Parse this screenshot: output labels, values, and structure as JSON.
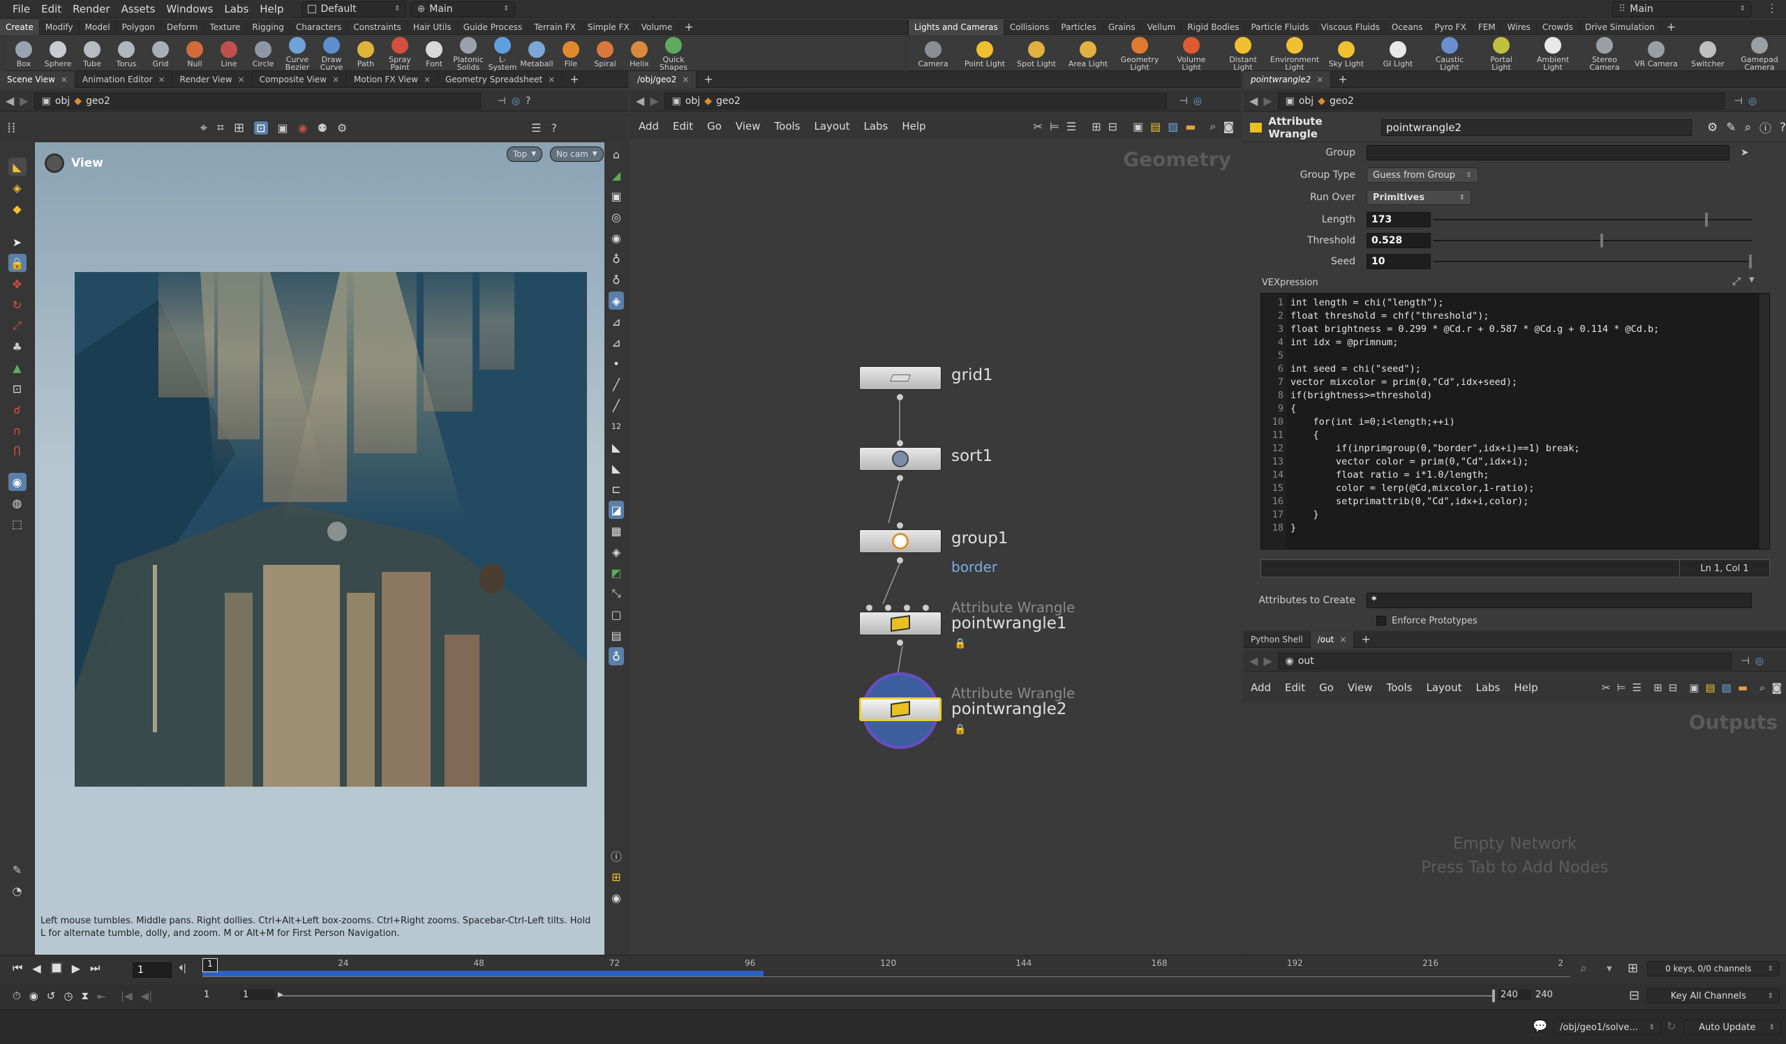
{
  "menubar": {
    "items": [
      "File",
      "Edit",
      "Render",
      "Assets",
      "Windows",
      "Labs",
      "Help"
    ],
    "desktop": "Default",
    "context": "Main",
    "right_context": "Main"
  },
  "shelf_left": {
    "tabs": [
      "Create",
      "Modify",
      "Model",
      "Polygon",
      "Deform",
      "Texture",
      "Rigging",
      "Characters",
      "Constraints",
      "Hair Utils",
      "Guide Process",
      "Terrain FX",
      "Simple FX",
      "Volume"
    ],
    "tools": [
      {
        "label": "Box",
        "color": "#9aa4b0"
      },
      {
        "label": "Sphere",
        "color": "#c8ccd2"
      },
      {
        "label": "Tube",
        "color": "#b7bcc3"
      },
      {
        "label": "Torus",
        "color": "#b0b6bd"
      },
      {
        "label": "Grid",
        "color": "#a9afb6"
      },
      {
        "label": "Null",
        "color": "#d46a3a"
      },
      {
        "label": "Line",
        "color": "#c0504d"
      },
      {
        "label": "Circle",
        "color": "#8e97a3"
      },
      {
        "label": "Curve Bezier",
        "color": "#6fa3d8"
      },
      {
        "label": "Draw Curve",
        "color": "#5b8fd0"
      },
      {
        "label": "Path",
        "color": "#e0b23a"
      },
      {
        "label": "Spray Paint",
        "color": "#d2503d"
      },
      {
        "label": "Font",
        "color": "#d9d9d9"
      },
      {
        "label": "Platonic Solids",
        "color": "#9aa1ab"
      },
      {
        "label": "L-System",
        "color": "#5da0e0"
      },
      {
        "label": "Metaball",
        "color": "#7aa7d6"
      },
      {
        "label": "File",
        "color": "#e08a2c"
      },
      {
        "label": "Spiral",
        "color": "#d9783a"
      },
      {
        "label": "Helix",
        "color": "#d98a3a"
      },
      {
        "label": "Quick Shapes",
        "color": "#5faa5f"
      }
    ]
  },
  "shelf_right": {
    "tabs": [
      "Lights and Cameras",
      "Collisions",
      "Particles",
      "Grains",
      "Vellum",
      "Rigid Bodies",
      "Particle Fluids",
      "Viscous Fluids",
      "Oceans",
      "Pyro FX",
      "FEM",
      "Wires",
      "Crowds",
      "Drive Simulation"
    ],
    "tools": [
      {
        "label": "Camera",
        "color": "#8a8f96"
      },
      {
        "label": "Point Light",
        "color": "#f0c030"
      },
      {
        "label": "Spot Light",
        "color": "#e0b040"
      },
      {
        "label": "Area Light",
        "color": "#e0b040"
      },
      {
        "label": "Geometry Light",
        "color": "#e07a30"
      },
      {
        "label": "Volume Light",
        "color": "#e05a30"
      },
      {
        "label": "Distant Light",
        "color": "#f0c030"
      },
      {
        "label": "Environment Light",
        "color": "#f0c030"
      },
      {
        "label": "Sky Light",
        "color": "#f0c030"
      },
      {
        "label": "GI Light",
        "color": "#e8e8e8"
      },
      {
        "label": "Caustic Light",
        "color": "#6a8fd0"
      },
      {
        "label": "Portal Light",
        "color": "#c0c040"
      },
      {
        "label": "Ambient Light",
        "color": "#e8e8e8"
      },
      {
        "label": "Stereo Camera",
        "color": "#9a9fa6"
      },
      {
        "label": "VR Camera",
        "color": "#9a9fa6"
      },
      {
        "label": "Switcher",
        "color": "#bfbfbf"
      },
      {
        "label": "Gamepad Camera",
        "color": "#9a9fa6"
      }
    ]
  },
  "viewport": {
    "tabs": [
      "Scene View",
      "Animation Editor",
      "Render View",
      "Composite View",
      "Motion FX View",
      "Geometry Spreadsheet"
    ],
    "path": {
      "root": "obj",
      "node": "geo2"
    },
    "title": "View",
    "view_mode": "Top",
    "camera": "No cam",
    "hint": "Left mouse tumbles. Middle pans. Right dollies. Ctrl+Alt+Left box-zooms. Ctrl+Right zooms. Spacebar-Ctrl-Left tilts. Hold L for alternate tumble, dolly, and zoom. M or Alt+M for First Person Navigation."
  },
  "network": {
    "tab": "/obj/geo2",
    "path": {
      "root": "obj",
      "node": "geo2"
    },
    "menu": [
      "Add",
      "Edit",
      "Go",
      "View",
      "Tools",
      "Layout",
      "Labs",
      "Help"
    ],
    "context_label": "Geometry",
    "nodes": [
      {
        "name": "grid1",
        "type": ""
      },
      {
        "name": "sort1",
        "type": ""
      },
      {
        "name": "group1",
        "type": "",
        "sub": "border"
      },
      {
        "name": "pointwrangle1",
        "type": "Attribute Wrangle"
      },
      {
        "name": "pointwrangle2",
        "type": "Attribute Wrangle"
      }
    ]
  },
  "params": {
    "tab": "pointwrangle2",
    "path": {
      "root": "obj",
      "node": "geo2"
    },
    "node_type": "Attribute Wrangle",
    "node_name": "pointwrangle2",
    "group_label": "Group",
    "group_value": "",
    "group_type_label": "Group Type",
    "group_type_value": "Guess from Group",
    "run_over_label": "Run Over",
    "run_over_value": "Primitives",
    "length_label": "Length",
    "length_value": "173",
    "length_fraction": 0.86,
    "threshold_label": "Threshold",
    "threshold_value": "0.528",
    "threshold_fraction": 0.528,
    "seed_label": "Seed",
    "seed_value": "10",
    "seed_fraction": 1.0,
    "vex_label": "VEXpression",
    "code_lines": [
      "int length = chi(\"length\");",
      "float threshold = chf(\"threshold\");",
      "float brightness = 0.299 * @Cd.r + 0.587 * @Cd.g + 0.114 * @Cd.b;",
      "int idx = @primnum;",
      "",
      "int seed = chi(\"seed\");",
      "vector mixcolor = prim(0,\"Cd\",idx+seed);",
      "if(brightness>=threshold)",
      "{",
      "    for(int i=0;i<length;++i)",
      "    {",
      "        if(inprimgroup(0,\"border\",idx+i)==1) break;",
      "        vector color = prim(0,\"Cd\",idx+i);",
      "        float ratio = i*1.0/length;",
      "        color = lerp(@Cd,mixcolor,1-ratio);",
      "        setprimattrib(0,\"Cd\",idx+i,color);",
      "    }",
      "}"
    ],
    "cursor_pos": "Ln 1, Col 1",
    "attr_create_label": "Attributes to Create",
    "attr_create_value": "*",
    "enforce_label": "Enforce Prototypes"
  },
  "outputs": {
    "tabs": [
      "Python Shell",
      "/out"
    ],
    "path": "out",
    "menu": [
      "Add",
      "Edit",
      "Go",
      "View",
      "Tools",
      "Layout",
      "Labs",
      "Help"
    ],
    "context_label": "Outputs",
    "empty_line1": "Empty Network",
    "empty_line2": "Press Tab to Add Nodes"
  },
  "timeline": {
    "current_frame": "1",
    "frame_marker": "1",
    "ticks": [
      {
        "label": "24",
        "frac": 0.0991
      },
      {
        "label": "48",
        "frac": 0.1982
      },
      {
        "label": "72",
        "frac": 0.2973
      },
      {
        "label": "96",
        "frac": 0.3964
      },
      {
        "label": "120",
        "frac": 0.4955
      },
      {
        "label": "144",
        "frac": 0.5946
      },
      {
        "label": "168",
        "frac": 0.6937
      },
      {
        "label": "192",
        "frac": 0.7928
      },
      {
        "label": "216",
        "frac": 0.8919
      },
      {
        "label": "2",
        "frac": 0.991
      }
    ],
    "cached_fraction": 0.41,
    "range_start": "1",
    "range_start2": "1",
    "range_end": "240",
    "range_end2": "240",
    "keys_info": "0 keys, 0/0 channels",
    "key_mode": "Key All Channels",
    "status_path": "/obj/geo1/solve...",
    "update_mode": "Auto Update"
  }
}
